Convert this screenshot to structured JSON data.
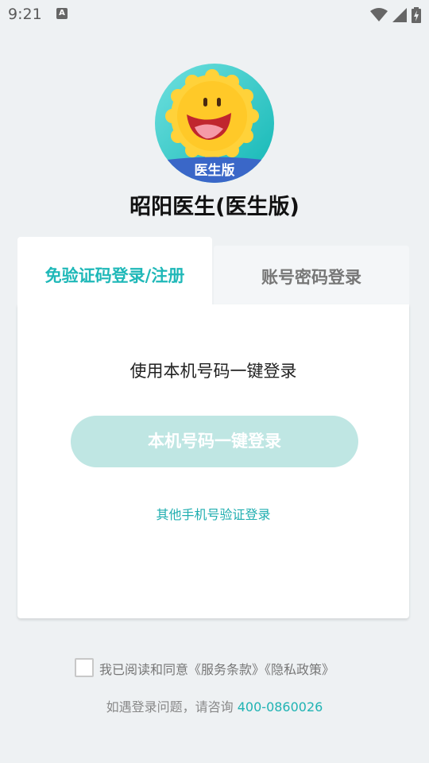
{
  "status_bar": {
    "time": "9:21",
    "notification_icon": "a-icon",
    "wifi_icon": "wifi-icon",
    "signal_icon": "signal-icon",
    "battery_icon": "battery-charging-icon"
  },
  "app": {
    "logo_badge": "医生版",
    "title": "昭阳医生(医生版)"
  },
  "tabs": [
    {
      "label": "免验证码登录/注册",
      "active": true
    },
    {
      "label": "账号密码登录",
      "active": false
    }
  ],
  "card": {
    "heading": "使用本机号码一键登录",
    "primary_button": "本机号码一键登录",
    "other_link": "其他手机号验证登录"
  },
  "agreement": {
    "checked": false,
    "text": "我已阅读和同意《服务条款》《隐私政策》"
  },
  "help": {
    "prefix": "如遇登录问题，请咨询 ",
    "phone": "400-0860026"
  },
  "colors": {
    "accent": "#1fb8b8",
    "button_disabled": "#bfe6e3",
    "background": "#eef1f3"
  }
}
